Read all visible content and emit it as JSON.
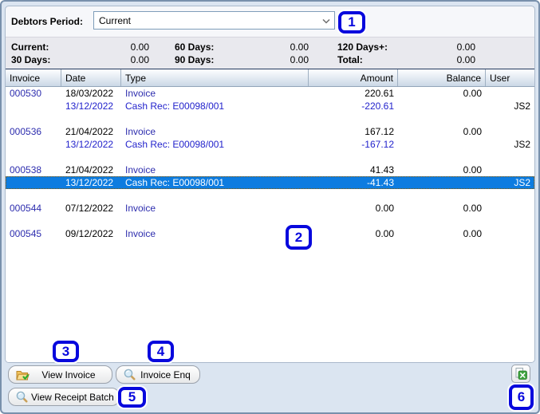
{
  "filter": {
    "label": "Debtors Period:",
    "value": "Current"
  },
  "summary": {
    "items": [
      {
        "label": "Current:",
        "value": "0.00"
      },
      {
        "label": "60 Days:",
        "value": "0.00"
      },
      {
        "label": "120 Days+:",
        "value": "0.00"
      },
      {
        "label": "30 Days:",
        "value": "0.00"
      },
      {
        "label": "90 Days:",
        "value": "0.00"
      },
      {
        "label": "Total:",
        "value": "0.00"
      }
    ]
  },
  "table": {
    "columns": [
      "Invoice",
      "Date",
      "Type",
      "Amount",
      "Balance",
      "User"
    ],
    "rows": [
      {
        "kind": "invoice",
        "invoice": "000530",
        "date": "18/03/2022",
        "type": "Invoice",
        "amount": "220.61",
        "balance": "0.00",
        "user": "",
        "selected": false
      },
      {
        "kind": "cash",
        "invoice": "",
        "date": "13/12/2022",
        "type": "Cash Rec: E00098/001",
        "amount": "-220.61",
        "balance": "",
        "user": "JS2",
        "selected": false
      },
      {
        "kind": "blank"
      },
      {
        "kind": "invoice",
        "invoice": "000536",
        "date": "21/04/2022",
        "type": "Invoice",
        "amount": "167.12",
        "balance": "0.00",
        "user": "",
        "selected": false
      },
      {
        "kind": "cash",
        "invoice": "",
        "date": "13/12/2022",
        "type": "Cash Rec: E00098/001",
        "amount": "-167.12",
        "balance": "",
        "user": "JS2",
        "selected": false
      },
      {
        "kind": "blank"
      },
      {
        "kind": "invoice",
        "invoice": "000538",
        "date": "21/04/2022",
        "type": "Invoice",
        "amount": "41.43",
        "balance": "0.00",
        "user": "",
        "selected": false
      },
      {
        "kind": "cash",
        "invoice": "",
        "date": "13/12/2022",
        "type": "Cash Rec: E00098/001",
        "amount": "-41.43",
        "balance": "",
        "user": "JS2",
        "selected": true
      },
      {
        "kind": "blank"
      },
      {
        "kind": "invoice",
        "invoice": "000544",
        "date": "07/12/2022",
        "type": "Invoice",
        "amount": "0.00",
        "balance": "0.00",
        "user": "",
        "selected": false
      },
      {
        "kind": "blank"
      },
      {
        "kind": "invoice",
        "invoice": "000545",
        "date": "09/12/2022",
        "type": "Invoice",
        "amount": "0.00",
        "balance": "0.00",
        "user": "",
        "selected": false
      }
    ]
  },
  "buttons": [
    {
      "id": "view-invoice",
      "label": "View Invoice",
      "icon": "folder-open-icon"
    },
    {
      "id": "invoice-enq",
      "label": "Invoice Enq",
      "icon": "magnifier-icon"
    },
    {
      "id": "view-receipt-batch",
      "label": "View Receipt Batch",
      "icon": "magnifier-icon"
    },
    {
      "id": "export-excel",
      "label": "",
      "icon": "excel-export-icon"
    }
  ],
  "annotations": [
    {
      "label": "1"
    },
    {
      "label": "2"
    },
    {
      "label": "3"
    },
    {
      "label": "4"
    },
    {
      "label": "5"
    },
    {
      "label": "6"
    }
  ],
  "colors": {
    "selection_bg": "#0d7ce0",
    "invoice_link_blue": "#2d2dae",
    "cash_rec_blue": "#2323cc",
    "annotation_blue": "#0808dd",
    "window_bg": "#dbe5f1"
  }
}
